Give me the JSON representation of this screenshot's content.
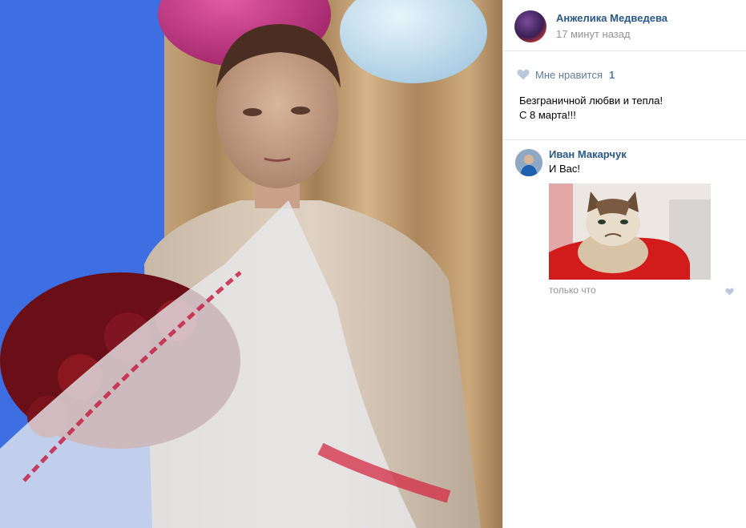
{
  "post": {
    "author": "Анжелика Медведева",
    "time": "17 минут назад",
    "likes_label": "Мне нравится",
    "likes_count": "1",
    "text_line1": "Безграничной любви и тепла!",
    "text_line2": "С 8 марта!!!"
  },
  "comment": {
    "author": "Иван Макарчук",
    "text": "И Вас!",
    "time": "только что"
  },
  "icons": {
    "like": "heart-icon",
    "comment_like": "heart-icon"
  },
  "colors": {
    "link": "#2a5885",
    "muted": "#939393",
    "like": "#5f7c9c",
    "heart": "#b9c9db",
    "separator": "#e7e8ec"
  }
}
